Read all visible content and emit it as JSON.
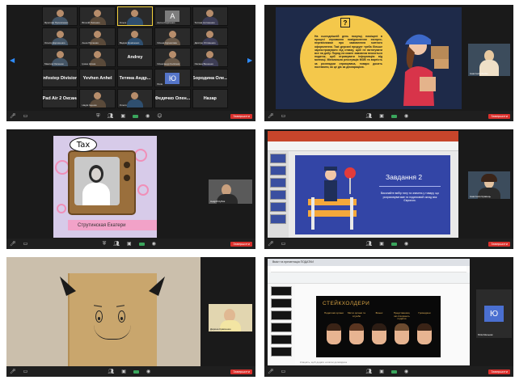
{
  "gallery": {
    "tiles": [
      {
        "name": "Ярослав Прокопенко",
        "kind": "person"
      },
      {
        "name": "Віталій Лисенко",
        "kind": "person"
      },
      {
        "name": "Ольга",
        "kind": "person",
        "active": true
      },
      {
        "name": "Антон Карпенко",
        "kind": "avatar",
        "letter": "A",
        "color": "#7d7d7d"
      },
      {
        "name": "Тетяна Антоненко",
        "kind": "person"
      },
      {
        "name": "Олеся Дорошенко",
        "kind": "person"
      },
      {
        "name": "Анна Юрченко",
        "kind": "person"
      },
      {
        "name": "Вадим Кравченко",
        "kind": "person"
      },
      {
        "name": "Олена Курносова",
        "kind": "person"
      },
      {
        "name": "Дмитро Устименко",
        "kind": "person"
      },
      {
        "name": "Максим Оксенюк",
        "kind": "person"
      },
      {
        "name": "Ірина Ничка",
        "kind": "person"
      },
      {
        "name": "Andrey",
        "kind": "text",
        "label": "Andrey"
      },
      {
        "name": "Олександр Колісник",
        "kind": "person"
      },
      {
        "name": "Оксана Вешенко",
        "kind": "person"
      },
      {
        "name": "Infostep Division",
        "kind": "text",
        "label": "Infostep Division"
      },
      {
        "name": "Yevhen Anhel",
        "kind": "text",
        "label": "Yevhen Anhel"
      },
      {
        "name": "Тетяна Андрейчук",
        "kind": "text",
        "label": "Тетяна Андр..."
      },
      {
        "name": "Юлія",
        "kind": "avatar",
        "letter": "Ю",
        "color": "#5575c9"
      },
      {
        "name": "Бородина Олена",
        "kind": "text",
        "label": "Бородина Оле..."
      },
      {
        "name": "iPad Air 2 Оксана",
        "kind": "text",
        "label": "iPad Air 2 Оксана"
      },
      {
        "name": "Надія Іщенко",
        "kind": "person"
      },
      {
        "name": "Олеся",
        "kind": "person"
      },
      {
        "name": "Федячко Олена",
        "kind": "text",
        "label": "Федячко Олен..."
      },
      {
        "name": "Назар",
        "kind": "text",
        "label": "Назар"
      }
    ]
  },
  "slide2": {
    "paragraph": "На сьогоднішній день покупці, поміщені в процесі отримання повідомлення експрес-перевізником про замовлення митного оформлення. Такі дерсані продукт треба більше зареєстровувати під ставку, щоб не витягувати все на добу. Поряд на кожен замовник вноситься податок, щоб отримувати інформацію від митниці. Мінімальна реєстрація МОВ та вартість за розглядом отримувача, товари досить поставити, як це діє за декларацією.",
    "icon_symbol": "?",
    "pip_name": "Анастасія Бойко"
  },
  "slide3": {
    "bubble": "Tax",
    "banner": "Струтинская Екатери",
    "pip_name": "Андрій Кубик"
  },
  "slide4": {
    "title": "Завдання 2",
    "subtitle": "Виконайте вибір типу та значень у товару, що розраховуватиме та податковий склад між Європою.",
    "pip_name": "Анастасія Кравець"
  },
  "slide5": {
    "pip_name": "Дарина Кравченко"
  },
  "slide6": {
    "tab_title": "Вміст та презентація ПОДАТКИ",
    "title": "СТЕЙКХОЛДЕРИ",
    "columns": [
      "Податкові органи",
      "Митні органи та служби",
      "Бізнес",
      "Представники, які створюють податки",
      "Громадяни"
    ],
    "notes": "Клацніть, щоб додати нотатки доповідача",
    "side_name": "Юлія Мельник",
    "side_letter": "Ю"
  },
  "toolbar": {
    "icons": [
      "microphone-icon",
      "video-icon",
      "security-icon",
      "participants-icon",
      "chat-icon",
      "share-icon",
      "record-icon",
      "reactions-icon"
    ],
    "end_label": "Завершити"
  }
}
